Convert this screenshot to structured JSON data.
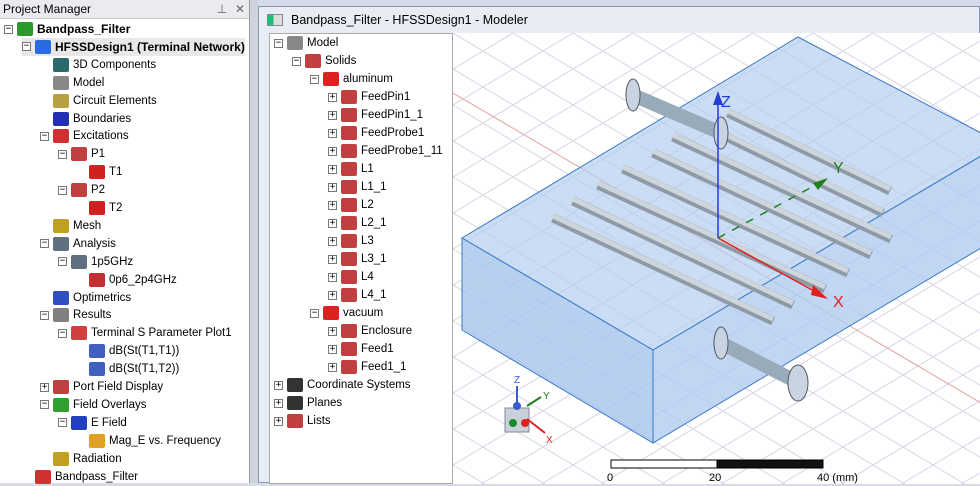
{
  "project_manager": {
    "title": "Project Manager",
    "pin_icon": "pin-icon",
    "close_icon": "close-icon",
    "items": [
      {
        "label": "Bandpass_Filter",
        "level": 0,
        "exp": "-",
        "icon": "project-icon",
        "color": "#2a9a2a",
        "bold": true
      },
      {
        "label": "HFSSDesign1 (Terminal Network)",
        "level": 1,
        "exp": "-",
        "icon": "design-icon",
        "color": "#2a6ae0",
        "bold": true,
        "sel": true
      },
      {
        "label": "3D Components",
        "level": 2,
        "icon": "components-icon",
        "color": "#2a6a6a"
      },
      {
        "label": "Model",
        "level": 2,
        "icon": "model-icon",
        "color": "#888"
      },
      {
        "label": "Circuit Elements",
        "level": 2,
        "icon": "circuit-icon",
        "color": "#b8a040"
      },
      {
        "label": "Boundaries",
        "level": 2,
        "icon": "boundaries-icon",
        "color": "#2030b0"
      },
      {
        "label": "Excitations",
        "level": 2,
        "exp": "-",
        "icon": "excitations-icon",
        "color": "#d03030"
      },
      {
        "label": "P1",
        "level": 3,
        "exp": "-",
        "icon": "port-icon",
        "color": "#c04040"
      },
      {
        "label": "T1",
        "level": 4,
        "icon": "terminal-icon",
        "color": "#d02020"
      },
      {
        "label": "P2",
        "level": 3,
        "exp": "-",
        "icon": "port-icon",
        "color": "#c04040"
      },
      {
        "label": "T2",
        "level": 4,
        "icon": "terminal-icon",
        "color": "#d02020"
      },
      {
        "label": "Mesh",
        "level": 2,
        "icon": "mesh-icon",
        "color": "#c0a020"
      },
      {
        "label": "Analysis",
        "level": 2,
        "exp": "-",
        "icon": "analysis-icon",
        "color": "#607080"
      },
      {
        "label": "1p5GHz",
        "level": 3,
        "exp": "-",
        "icon": "setup-icon",
        "color": "#607080"
      },
      {
        "label": "0p6_2p4GHz",
        "level": 4,
        "icon": "sweep-icon",
        "color": "#c03030"
      },
      {
        "label": "Optimetrics",
        "level": 2,
        "icon": "optimetrics-icon",
        "color": "#3050c0"
      },
      {
        "label": "Results",
        "level": 2,
        "exp": "-",
        "icon": "results-icon",
        "color": "#808080"
      },
      {
        "label": "Terminal S Parameter Plot1",
        "level": 3,
        "exp": "-",
        "icon": "plot-icon",
        "color": "#d04040"
      },
      {
        "label": "dB(St(T1,T1))",
        "level": 4,
        "icon": "trace-icon",
        "color": "#4060c0"
      },
      {
        "label": "dB(St(T1,T2))",
        "level": 4,
        "icon": "trace-icon",
        "color": "#4060c0"
      },
      {
        "label": "Port Field Display",
        "level": 2,
        "exp": "+",
        "icon": "port-field-icon",
        "color": "#c04040"
      },
      {
        "label": "Field Overlays",
        "level": 2,
        "exp": "-",
        "icon": "field-overlays-icon",
        "color": "#30a030"
      },
      {
        "label": "E Field",
        "level": 3,
        "exp": "-",
        "icon": "efield-icon",
        "color": "#2040c0"
      },
      {
        "label": "Mag_E vs. Frequency",
        "level": 4,
        "icon": "plot-points-icon",
        "color": "#e0a020"
      },
      {
        "label": "Radiation",
        "level": 2,
        "icon": "radiation-icon",
        "color": "#c0a020"
      },
      {
        "label": "Bandpass_Filter",
        "level": 1,
        "icon": "pdf-icon",
        "color": "#d03030"
      }
    ]
  },
  "modeler": {
    "title": "Bandpass_Filter - HFSSDesign1 - Modeler",
    "tree": [
      {
        "label": "Model",
        "level": 0,
        "exp": "-",
        "icon": "model-icon",
        "color": "#888"
      },
      {
        "label": "Solids",
        "level": 1,
        "exp": "-",
        "icon": "solid-icon",
        "color": "#c04040"
      },
      {
        "label": "aluminum",
        "level": 2,
        "exp": "-",
        "icon": "material-icon",
        "color": "#e02020"
      },
      {
        "label": "FeedPin1",
        "level": 3,
        "exp": "+",
        "icon": "solid-icon",
        "color": "#c04040"
      },
      {
        "label": "FeedPin1_1",
        "level": 3,
        "exp": "+",
        "icon": "solid-icon",
        "color": "#c04040"
      },
      {
        "label": "FeedProbe1",
        "level": 3,
        "exp": "+",
        "icon": "solid-icon",
        "color": "#c04040"
      },
      {
        "label": "FeedProbe1_11",
        "level": 3,
        "exp": "+",
        "icon": "solid-icon",
        "color": "#c04040"
      },
      {
        "label": "L1",
        "level": 3,
        "exp": "+",
        "icon": "solid-icon",
        "color": "#c04040"
      },
      {
        "label": "L1_1",
        "level": 3,
        "exp": "+",
        "icon": "solid-icon",
        "color": "#c04040"
      },
      {
        "label": "L2",
        "level": 3,
        "exp": "+",
        "icon": "solid-icon",
        "color": "#c04040"
      },
      {
        "label": "L2_1",
        "level": 3,
        "exp": "+",
        "icon": "solid-icon",
        "color": "#c04040"
      },
      {
        "label": "L3",
        "level": 3,
        "exp": "+",
        "icon": "solid-icon",
        "color": "#c04040"
      },
      {
        "label": "L3_1",
        "level": 3,
        "exp": "+",
        "icon": "solid-icon",
        "color": "#c04040"
      },
      {
        "label": "L4",
        "level": 3,
        "exp": "+",
        "icon": "solid-icon",
        "color": "#c04040"
      },
      {
        "label": "L4_1",
        "level": 3,
        "exp": "+",
        "icon": "solid-icon",
        "color": "#c04040"
      },
      {
        "label": "vacuum",
        "level": 2,
        "exp": "-",
        "icon": "material-icon",
        "color": "#e02020"
      },
      {
        "label": "Enclosure",
        "level": 3,
        "exp": "+",
        "icon": "solid-icon",
        "color": "#c04040"
      },
      {
        "label": "Feed1",
        "level": 3,
        "exp": "+",
        "icon": "solid-icon",
        "color": "#c04040"
      },
      {
        "label": "Feed1_1",
        "level": 3,
        "exp": "+",
        "icon": "solid-icon",
        "color": "#c04040"
      },
      {
        "label": "Coordinate Systems",
        "level": 0,
        "exp": "+",
        "icon": "coordinate-icon",
        "color": "#333"
      },
      {
        "label": "Planes",
        "level": 0,
        "exp": "+",
        "icon": "planes-icon",
        "color": "#333"
      },
      {
        "label": "Lists",
        "level": 0,
        "exp": "+",
        "icon": "lists-icon",
        "color": "#c04040"
      }
    ],
    "axes": {
      "x": "X",
      "y": "Y",
      "z": "Z"
    },
    "scale": {
      "t0": "0",
      "t1": "20",
      "t2": "40 (mm)"
    }
  }
}
